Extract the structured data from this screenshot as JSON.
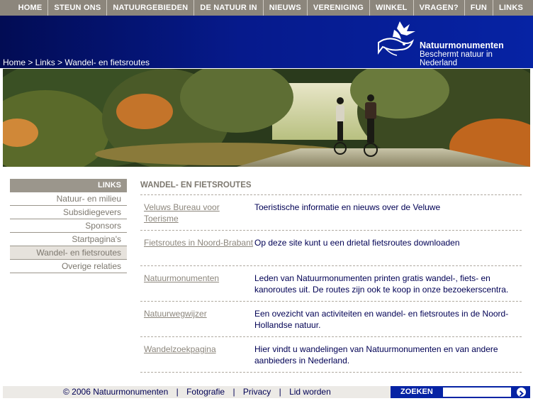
{
  "nav": {
    "items": [
      "HOME",
      "STEUN ONS",
      "NATUURGEBIEDEN",
      "DE NATUUR IN",
      "NIEUWS",
      "VERENIGING",
      "WINKEL",
      "VRAGEN?",
      "FUN",
      "LINKS"
    ]
  },
  "header": {
    "logo_name": "Natuurmonumenten",
    "logo_tagline": "Beschermt natuur in Nederland",
    "breadcrumb": "Home > Links > Wandel- en fietsroutes"
  },
  "sidebar": {
    "heading": "LINKS",
    "items": [
      "Natuur- en milieu",
      "Subsidiegevers",
      "Sponsors",
      "Startpagina's",
      "Wandel- en fietsroutes",
      "Overige relaties"
    ]
  },
  "main": {
    "title": "WANDEL- EN FIETSROUTES",
    "rows": [
      {
        "link": "Veluws Bureau voor Toerisme",
        "desc": "Toeristische informatie en nieuws over de Veluwe"
      },
      {
        "link": "Fietsroutes in Noord-Brabant",
        "desc": "Op deze site kunt u een drietal fietsroutes downloaden"
      },
      {
        "link": "Natuurmonumenten",
        "desc": "Leden van Natuurmonumenten printen gratis wandel-, fiets- en kanoroutes uit. De routes zijn ook te koop in onze bezoekerscentra."
      },
      {
        "link": "Natuurwegwijzer",
        "desc": "Een ovezicht van activiteiten en wandel- en fietsroutes in de Noord-Hollandse natuur."
      },
      {
        "link": "Wandelzoekpagina",
        "desc": "Hier vindt u wandelingen van Natuurmonumenten en van andere aanbieders in Nederland."
      }
    ]
  },
  "footer": {
    "copyright": "© 2006 Natuurmonumenten",
    "links": [
      "Fotografie",
      "Privacy",
      "Lid worden"
    ],
    "separator": "|",
    "search_label": "ZOEKEN"
  },
  "icons": {
    "logo": "bird-fish-logo-icon",
    "search_go": "arrow-right-circle-icon"
  },
  "colors": {
    "nav_bg": "#8c867c",
    "header_blue": "#0623a4",
    "link_grey": "#8c867c",
    "text_navy": "#000054"
  }
}
